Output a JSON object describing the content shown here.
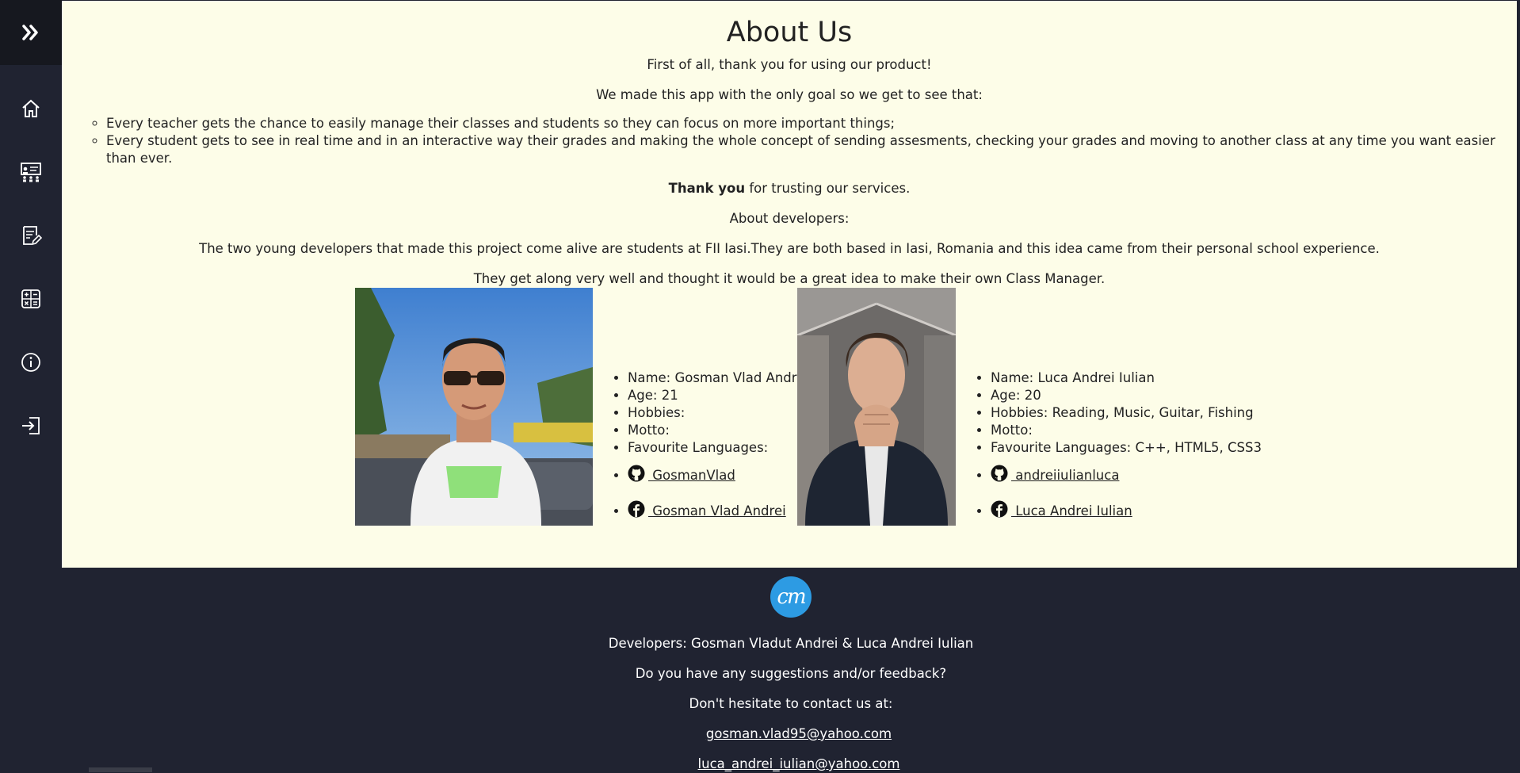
{
  "sidebar": {
    "toggle_icon": "double-chevron-right-icon",
    "items": [
      {
        "icon": "home-icon"
      },
      {
        "icon": "classroom-teacher-icon"
      },
      {
        "icon": "assessment-edit-icon"
      },
      {
        "icon": "calculator-icon"
      },
      {
        "icon": "info-icon"
      },
      {
        "icon": "sign-in-icon"
      }
    ]
  },
  "main": {
    "title": "About Us",
    "intro": "First of all, thank you for using our product!",
    "goal_line": "We made this app with the only goal so we get to see that:",
    "goals": [
      "Every teacher gets the chance to easily manage their classes and students so they can focus on more important things;",
      "Every student gets to see in real time and in an interactive way their grades and making the whole concept of sending assesments, checking your grades and moving to another class at any time you want easier than ever."
    ],
    "thanks_bold": "Thank you",
    "thanks_rest": " for trusting our services.",
    "about_devs_heading": "About developers:",
    "about_devs_text": "The two young developers that made this project come alive are students at FII Iasi.They are both based in Iasi, Romania and this idea came from their personal school experience.",
    "about_devs_text2": "They get along very well and thought it would be a great idea to make their own Class Manager."
  },
  "developers": [
    {
      "name": "Name: Gosman Vlad Andrei",
      "age": "Age: 21",
      "hobbies": "Hobbies:",
      "motto": "Motto:",
      "languages": "Favourite Languages:",
      "github": " GosmanVlad",
      "facebook": " Gosman Vlad Andrei"
    },
    {
      "name": "Name: Luca Andrei Iulian",
      "age": "Age: 20",
      "hobbies": "Hobbies: Reading, Music, Guitar, Fishing",
      "motto": "Motto:",
      "languages": "Favourite Languages: C++, HTML5, CSS3",
      "github": " andreiiulianluca",
      "facebook": " Luca Andrei Iulian"
    }
  ],
  "footer": {
    "logo_text": "cm",
    "developers": "Developers: Gosman Vladut Andrei & Luca Andrei Iulian",
    "suggestions": "Do you have any suggestions and/or feedback?",
    "contact": "Don't hesitate to contact us at:",
    "email1": "gosman.vlad95@yahoo.com",
    "email2": "luca_andrei_iulian@yahoo.com"
  },
  "colors": {
    "sidebar_bg": "#202331",
    "content_bg": "#fdfde8",
    "logo_bg": "#2d9be3"
  }
}
